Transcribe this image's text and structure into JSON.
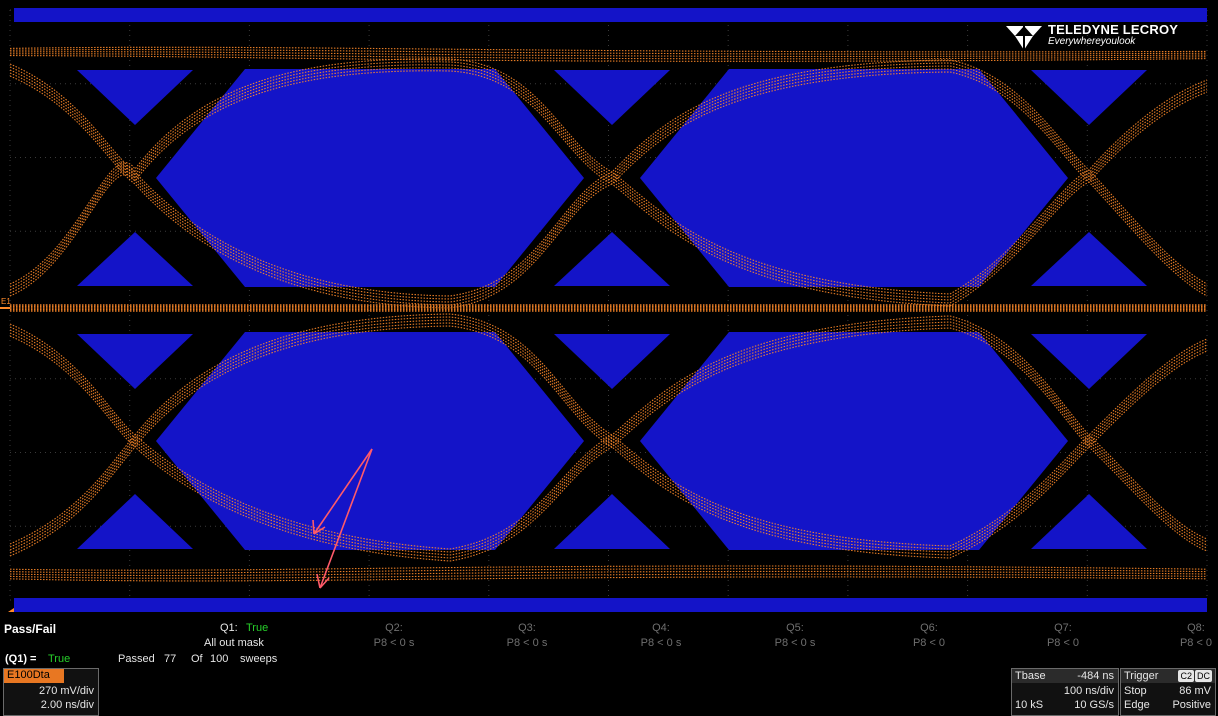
{
  "app": {
    "brand": "TELEDYNE LECROY",
    "tagline": "Everywhereyoulook"
  },
  "colors": {
    "mask": "#1414c8",
    "trace": "#ff8a2a",
    "pass": "#27d02a",
    "channel_label": "#e87722",
    "annotation": "#ff5a6a",
    "background": "#000000"
  },
  "grid_marker": {
    "level_label": "E1"
  },
  "pass_fail": {
    "title": "Pass/Fail",
    "q1_label": "Q1:",
    "q1_value": "True",
    "q1_desc": "All out mask",
    "summary_label": "(Q1) =",
    "summary_value": "True",
    "passed_text": "Passed",
    "passed_count": "77",
    "of_text": "Of",
    "total": "100",
    "sweeps_text": "sweeps",
    "qualifiers": [
      {
        "label": "Q2:",
        "value": "P8 < 0 s"
      },
      {
        "label": "Q3:",
        "value": "P8 < 0 s"
      },
      {
        "label": "Q4:",
        "value": "P8 < 0 s"
      },
      {
        "label": "Q5:",
        "value": "P8 < 0 s"
      },
      {
        "label": "Q6:",
        "value": "P8 < 0"
      },
      {
        "label": "Q7:",
        "value": "P8 < 0"
      },
      {
        "label": "Q8:",
        "value": "P8 < 0"
      }
    ]
  },
  "channel": {
    "name": "E100Dta",
    "vdiv": "270 mV/div",
    "tdiv": "2.00 ns/div"
  },
  "timebase": {
    "label": "Tbase",
    "delay": "-484 ns",
    "tdiv": "100 ns/div",
    "samples": "10 kS",
    "rate": "10 GS/s"
  },
  "trigger": {
    "label": "Trigger",
    "channel_badge": "C2",
    "coupling_badge": "DC",
    "mode": "Stop",
    "level": "86 mV",
    "type": "Edge",
    "slope": "Positive"
  }
}
